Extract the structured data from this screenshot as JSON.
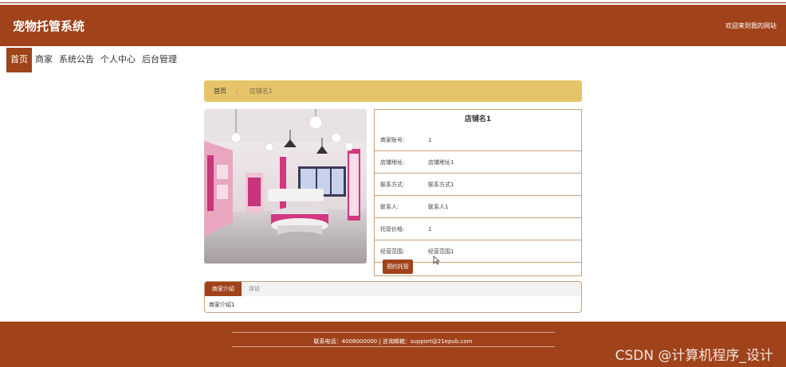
{
  "header": {
    "site_title": "宠物托管系统",
    "welcome": "欢迎来到我的网站"
  },
  "nav": {
    "items": [
      "首页",
      "商家",
      "系统公告",
      "个人中心",
      "后台管理"
    ],
    "active_index": 0
  },
  "breadcrumb": {
    "home": "首页",
    "separator": "/",
    "current": "店铺名1"
  },
  "shop": {
    "name": "店铺名1",
    "fields": [
      {
        "label": "商家账号:",
        "value": "1"
      },
      {
        "label": "店铺地址:",
        "value": "店铺地址1"
      },
      {
        "label": "联系方式:",
        "value": "联系方式1"
      },
      {
        "label": "联系人:",
        "value": "联系人1"
      },
      {
        "label": "托管价格:",
        "value": "1"
      },
      {
        "label": "经营范围:",
        "value": "经营范围1"
      }
    ],
    "book_button": "预约托管"
  },
  "tabs": {
    "items": [
      "商家介绍",
      "评论"
    ],
    "active_index": 0,
    "content": "商家介绍1"
  },
  "footer": {
    "contact": "联系电话：4008000000 | 咨询邮箱：support@21epub.com"
  },
  "watermark": "CSDN @计算机程序_设计",
  "colors": {
    "brand": "#a0431a",
    "breadcrumb_bg": "#e6c56a",
    "border": "#c9a07e"
  }
}
